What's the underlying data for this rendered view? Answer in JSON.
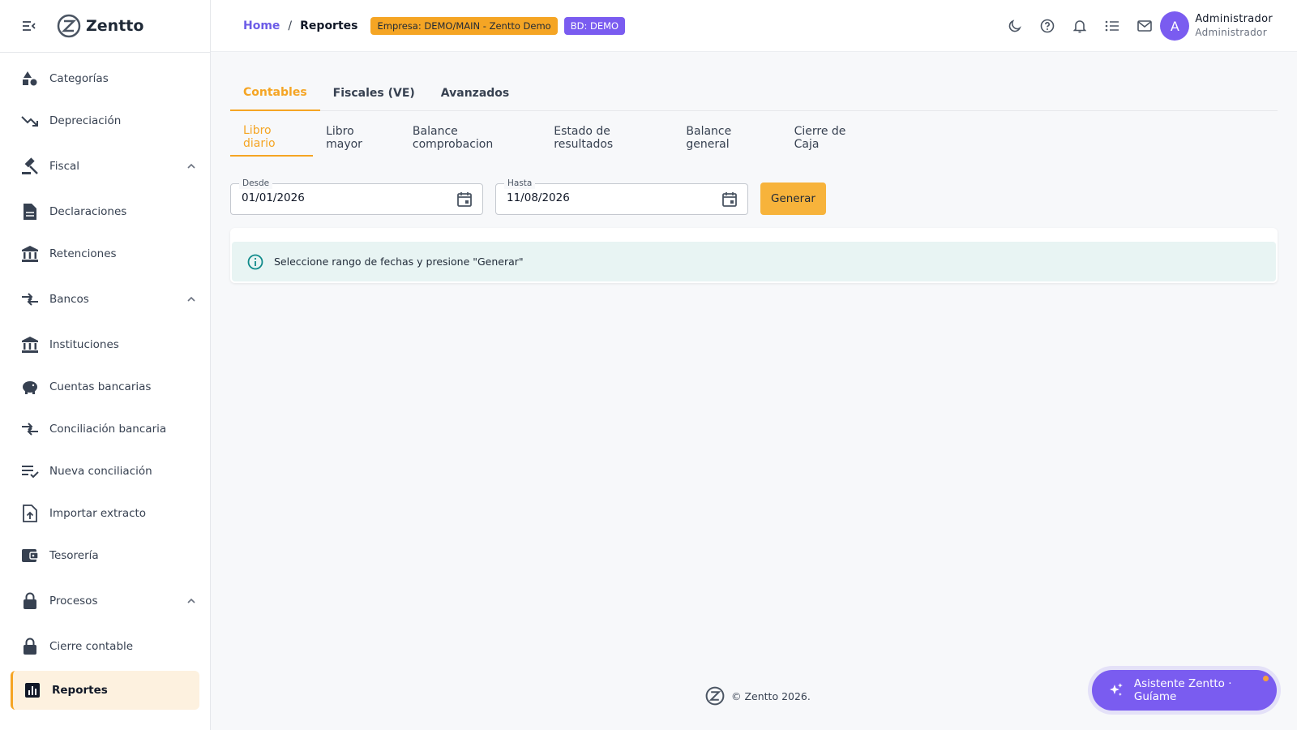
{
  "brand": {
    "name": "Zentto"
  },
  "sidebar": {
    "items": [
      {
        "label": "Categorías",
        "icon": "shapes-icon"
      },
      {
        "label": "Depreciación",
        "icon": "trending-down-icon"
      },
      {
        "label": "Fiscal",
        "icon": "gavel-icon",
        "group": true,
        "expanded": true
      },
      {
        "label": "Declaraciones",
        "icon": "document-icon"
      },
      {
        "label": "Retenciones",
        "icon": "bank-icon"
      },
      {
        "label": "Bancos",
        "icon": "swap-icon",
        "group": true,
        "expanded": true
      },
      {
        "label": "Instituciones",
        "icon": "bank-icon"
      },
      {
        "label": "Cuentas bancarias",
        "icon": "piggy-bank-icon"
      },
      {
        "label": "Conciliación bancaria",
        "icon": "swap-icon"
      },
      {
        "label": "Nueva conciliación",
        "icon": "playlist-check-icon"
      },
      {
        "label": "Importar extracto",
        "icon": "file-upload-icon"
      },
      {
        "label": "Tesorería",
        "icon": "wallet-icon"
      },
      {
        "label": "Procesos",
        "icon": "lock-icon",
        "group": true,
        "expanded": true
      },
      {
        "label": "Cierre contable",
        "icon": "lock-icon"
      },
      {
        "label": "Reportes",
        "icon": "bar-chart-icon",
        "active": true
      }
    ]
  },
  "header": {
    "breadcrumb": {
      "home": "Home",
      "separator": "/",
      "current": "Reportes"
    },
    "badges": {
      "empresa": "Empresa: DEMO/MAIN - Zentto Demo",
      "bd": "BD: DEMO"
    },
    "icons": [
      "moon-icon",
      "help-icon",
      "bell-icon",
      "list-icon",
      "mail-icon"
    ],
    "user": {
      "initial": "A",
      "name": "Administrador",
      "role": "Administrador"
    }
  },
  "tabs": {
    "primary": [
      "Contables",
      "Fiscales (VE)",
      "Avanzados"
    ],
    "primary_active": 0,
    "secondary": [
      "Libro diario",
      "Libro mayor",
      "Balance comprobacion",
      "Estado de resultados",
      "Balance general",
      "Cierre de Caja"
    ],
    "secondary_active": 0
  },
  "filters": {
    "desde": {
      "label": "Desde",
      "value": "01/01/2026"
    },
    "hasta": {
      "label": "Hasta",
      "value": "11/08/2026"
    },
    "generate_label": "Generar"
  },
  "alert": {
    "text": "Seleccione rango de fechas y presione \"Generar\""
  },
  "footer": {
    "text": "© Zentto 2026."
  },
  "assistant": {
    "label": "Asistente Zentto · Guíame"
  },
  "colors": {
    "accent": "#f5a524",
    "primary": "#7a5cf0",
    "info": "#0f8a8a"
  }
}
